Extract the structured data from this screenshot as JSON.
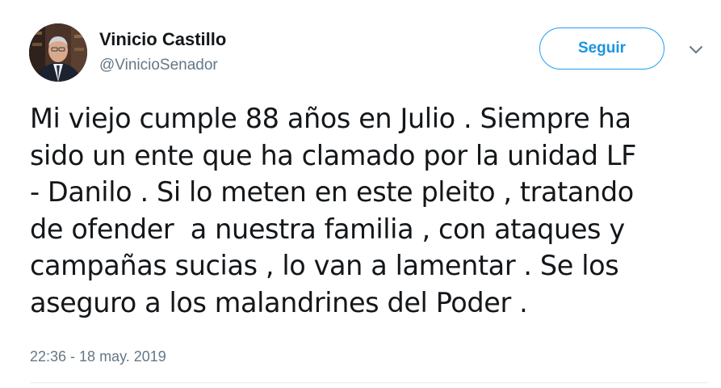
{
  "author": {
    "name": "Vinicio Castillo",
    "handle": "@VinicioSenador"
  },
  "follow": {
    "label": "Seguir"
  },
  "tweet": {
    "lines": [
      "Mi viejo cumple 88 años en Julio . Siempre ha",
      "sido un ente que ha clamado por la unidad LF",
      "- Danilo . Si lo meten en este pleito , tratando",
      "de ofender  a nuestra familia , con ataques y",
      "campañas sucias , lo van a lamentar . Se los",
      "aseguro a los malandrines del Poder ."
    ],
    "timestamp": "22:36 - 18 may. 2019"
  },
  "colors": {
    "accent": "#1da1f2",
    "text": "#14171a",
    "secondary_text": "#657786",
    "divider": "#e6ecf0"
  },
  "icons": {
    "caret": "chevron-down-icon",
    "avatar": "profile-photo"
  }
}
